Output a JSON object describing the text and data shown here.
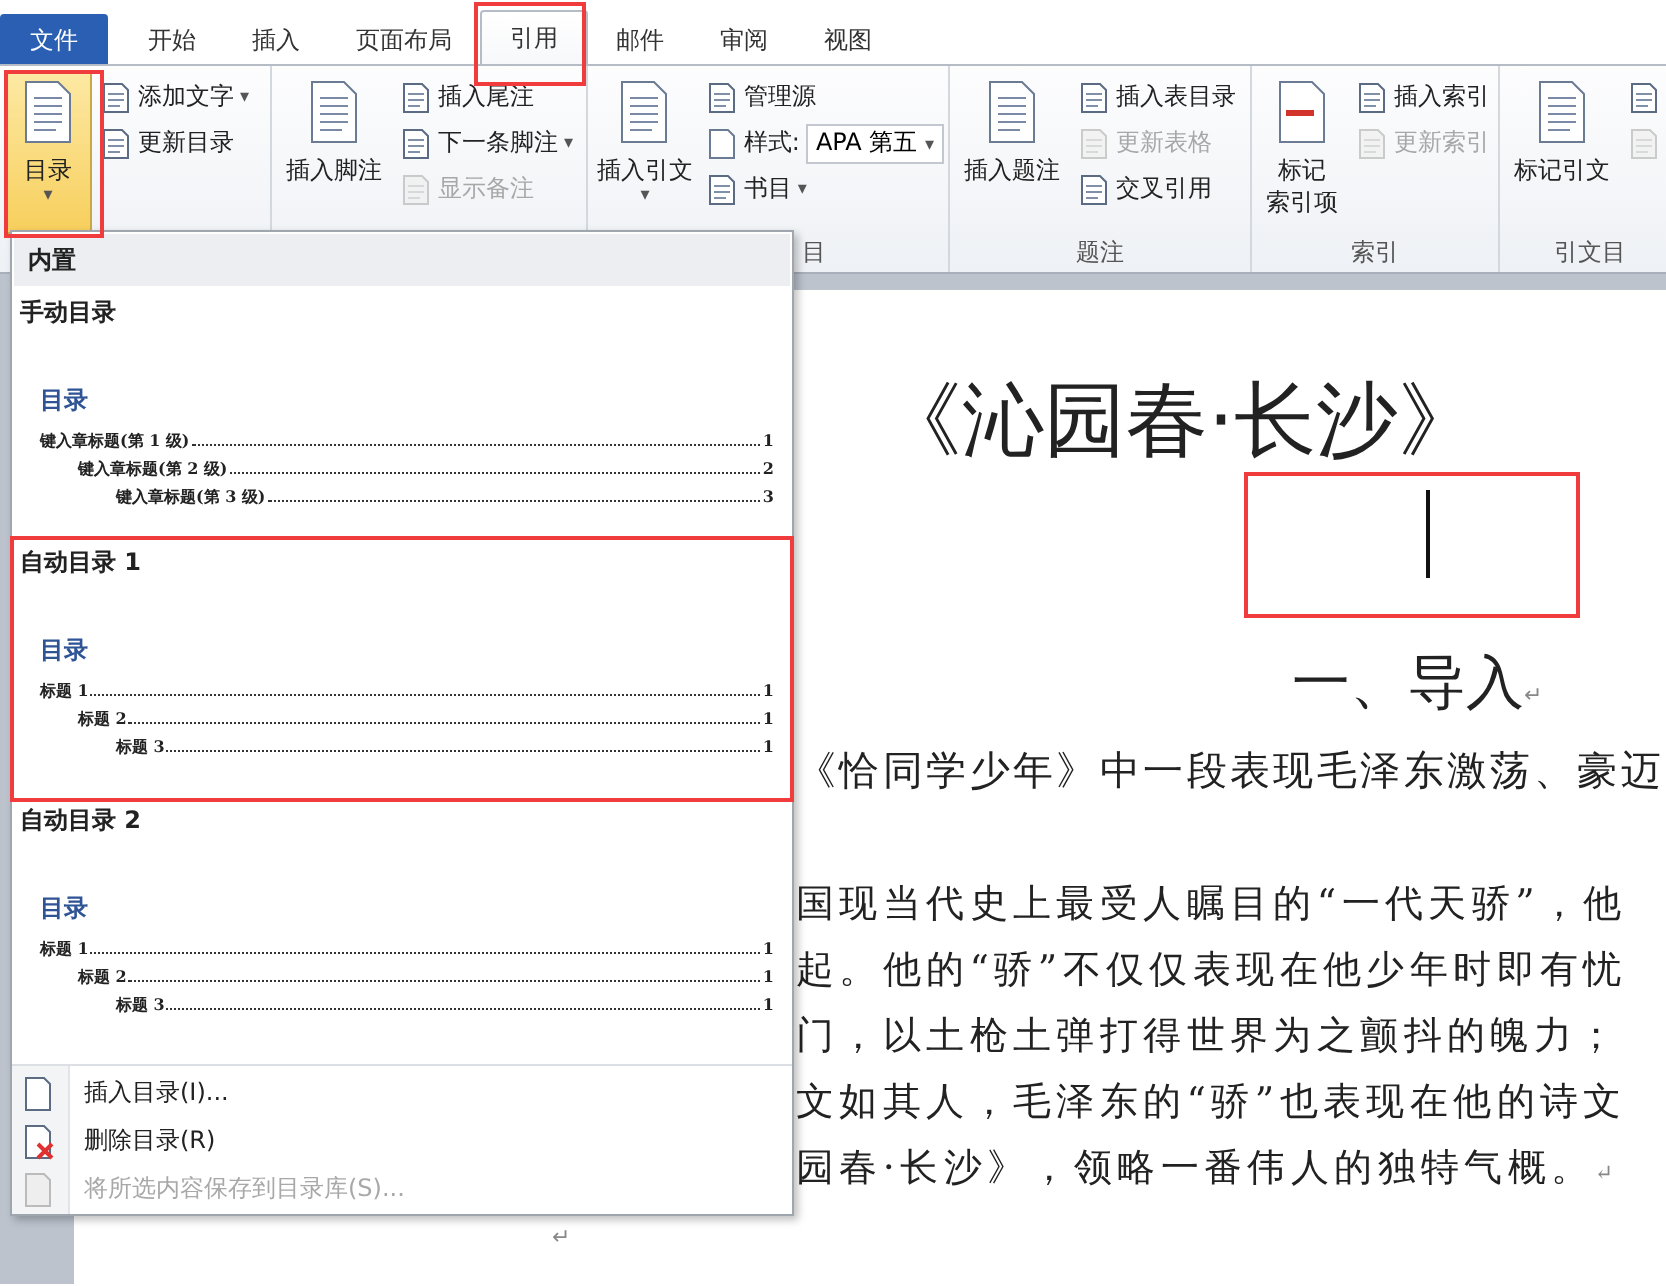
{
  "tabs": [
    {
      "label": "文件",
      "kind": "file",
      "selected": false
    },
    {
      "label": "开始",
      "kind": "tab",
      "selected": false
    },
    {
      "label": "插入",
      "kind": "tab",
      "selected": false
    },
    {
      "label": "页面布局",
      "kind": "tab",
      "selected": false
    },
    {
      "label": "引用",
      "kind": "tab",
      "selected": true
    },
    {
      "label": "邮件",
      "kind": "tab",
      "selected": false
    },
    {
      "label": "审阅",
      "kind": "tab",
      "selected": false
    },
    {
      "label": "视图",
      "kind": "tab",
      "selected": false
    }
  ],
  "ribbon": {
    "groups": [
      {
        "large": [
          {
            "lines": [
              "目录"
            ],
            "caret": "▾",
            "pressed": true
          }
        ],
        "small": [
          {
            "label": "添加文字",
            "caret": "▾",
            "disabled": false
          },
          {
            "label": "更新目录",
            "disabled": false
          }
        ]
      },
      {
        "large": [
          {
            "lines": [
              "插入脚注"
            ],
            "pressed": false
          }
        ],
        "small": [
          {
            "label": "插入尾注",
            "disabled": false
          },
          {
            "label": "下一条脚注",
            "caret": "▾",
            "disabled": false
          },
          {
            "label": "显示备注",
            "disabled": true
          }
        ]
      },
      {
        "label": "目",
        "large": [
          {
            "lines": [
              "插入引文"
            ],
            "caret": "▾",
            "pressed": false
          }
        ],
        "small": [
          {
            "label": "管理源",
            "disabled": false
          },
          {
            "label": "样式:",
            "kind": "combo",
            "value": "APA 第五",
            "caret": "▾"
          },
          {
            "label": "书目",
            "caret": "▾",
            "disabled": false
          }
        ]
      },
      {
        "label": "题注",
        "large": [
          {
            "lines": [
              "插入题注"
            ],
            "pressed": false
          }
        ],
        "small": [
          {
            "label": "插入表目录",
            "disabled": false
          },
          {
            "label": "更新表格",
            "disabled": true
          },
          {
            "label": "交叉引用",
            "disabled": false
          }
        ]
      },
      {
        "label": "索引",
        "large": [
          {
            "lines": [
              "标记",
              "索引项"
            ],
            "pressed": false
          }
        ],
        "small": [
          {
            "label": "插入索引",
            "disabled": false
          },
          {
            "label": "更新索引",
            "disabled": true
          }
        ]
      },
      {
        "label": "引文目",
        "large": [
          {
            "lines": [
              "标记引文"
            ],
            "pressed": false
          }
        ],
        "small": [
          {
            "kind": "icon",
            "disabled": false
          },
          {
            "kind": "icon",
            "disabled": true
          }
        ]
      }
    ]
  },
  "dropdown": {
    "header": "内置",
    "gallery": [
      {
        "title": "手动目录",
        "heading": "目录",
        "entries": [
          {
            "text": "键入章标题(第 1 级)",
            "page": "1"
          },
          {
            "text": "键入章标题(第 2 级)",
            "page": "2"
          },
          {
            "text": "键入章标题(第 3 级)",
            "page": "3"
          }
        ]
      },
      {
        "title": "自动目录 1",
        "heading": "目录",
        "entries": [
          {
            "text": "标题 1",
            "page": "1"
          },
          {
            "text": "标题 2",
            "page": "1"
          },
          {
            "text": "标题 3",
            "page": "1"
          }
        ]
      },
      {
        "title": "自动目录 2",
        "heading": "目录",
        "entries": [
          {
            "text": "标题 1",
            "page": "1"
          },
          {
            "text": "标题 2",
            "page": "1"
          },
          {
            "text": "标题 3",
            "page": "1"
          }
        ]
      }
    ],
    "commands": [
      {
        "label": "插入目录(I)...",
        "disabled": false
      },
      {
        "label": "删除目录(R)",
        "disabled": false
      },
      {
        "label": "将所选内容保存到目录库(S)...",
        "disabled": true
      }
    ]
  },
  "document": {
    "title": "《沁园春·长沙》",
    "heading": "一、导入",
    "mark": "↵",
    "lines": [
      {
        "text": "《恰同学少年》中一段表现毛泽东激荡、豪迈",
        "kind": "sans"
      },
      {
        "text": "国现当代史上最受人瞩目的“一代天骄”，他",
        "kind": "serif"
      },
      {
        "text": "起。他的“骄”不仅仅表现在他少年时即有忧",
        "kind": "serif"
      },
      {
        "text": "门，以土枪土弹打得世界为之颤抖的魄力；",
        "kind": "serif"
      },
      {
        "text": "文如其人，毛泽东的“骄”也表现在他的诗文",
        "kind": "serif"
      },
      {
        "text": "园春·长沙》，领略一番伟人的独特气概。",
        "kind": "serif",
        "mark": "↵"
      }
    ],
    "end_mark": "↵"
  }
}
